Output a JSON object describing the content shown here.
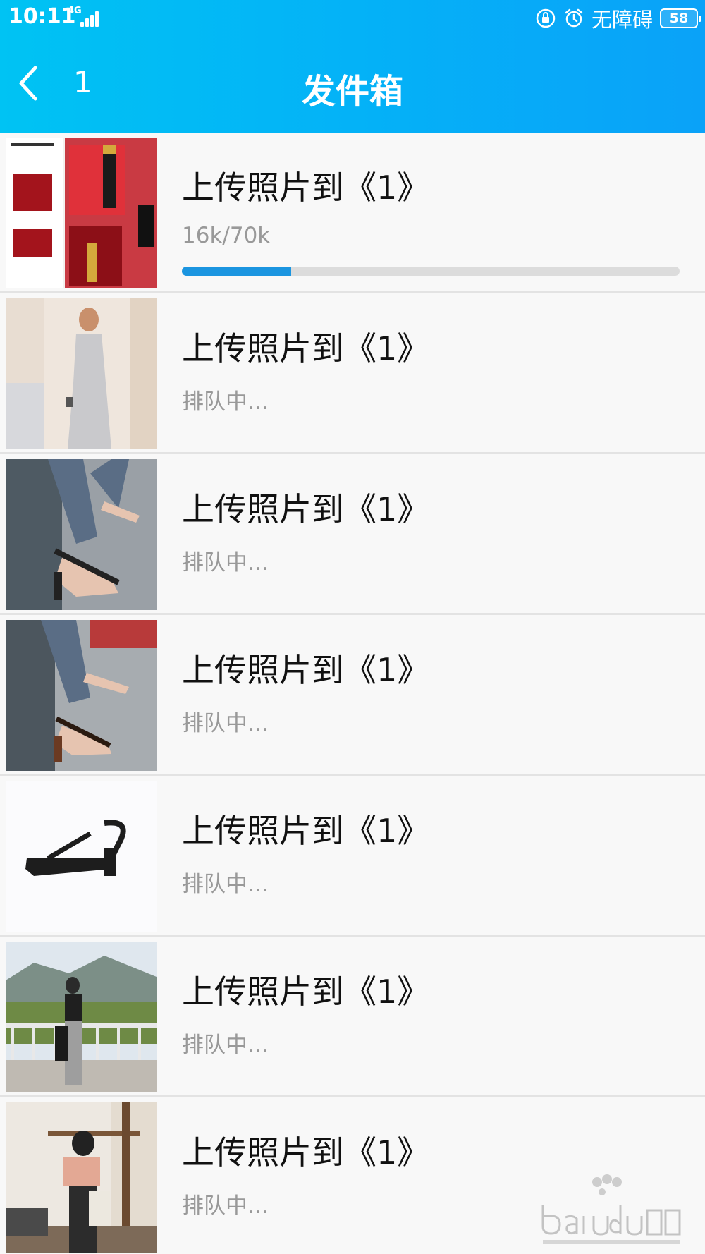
{
  "status_bar": {
    "time": "10:11",
    "network": "4G",
    "accessibility_label": "无障碍",
    "battery": "58"
  },
  "header": {
    "back_label": "1",
    "title": "发件箱"
  },
  "uploads": [
    {
      "title": "上传照片到《1》",
      "status": "16k/70k",
      "progress": 0.22,
      "thumb": "lipstick-ad"
    },
    {
      "title": "上传照片到《1》",
      "status": "排队中...",
      "thumb": "woman-in-dress"
    },
    {
      "title": "上传照片到《1》",
      "status": "排队中...",
      "thumb": "sandals-street"
    },
    {
      "title": "上传照片到《1》",
      "status": "排队中...",
      "thumb": "sandals-street-2"
    },
    {
      "title": "上传照片到《1》",
      "status": "排队中...",
      "thumb": "black-sandal-product"
    },
    {
      "title": "上传照片到《1》",
      "status": "排队中...",
      "thumb": "woman-on-balcony"
    },
    {
      "title": "上传照片到《1》",
      "status": "排队中...",
      "thumb": "woman-indoor"
    }
  ],
  "colors": {
    "header_start": "#00c3f3",
    "header_end": "#0aa2f8",
    "progress_fill": "#1b95e0",
    "progress_track": "#dcdcdc"
  }
}
